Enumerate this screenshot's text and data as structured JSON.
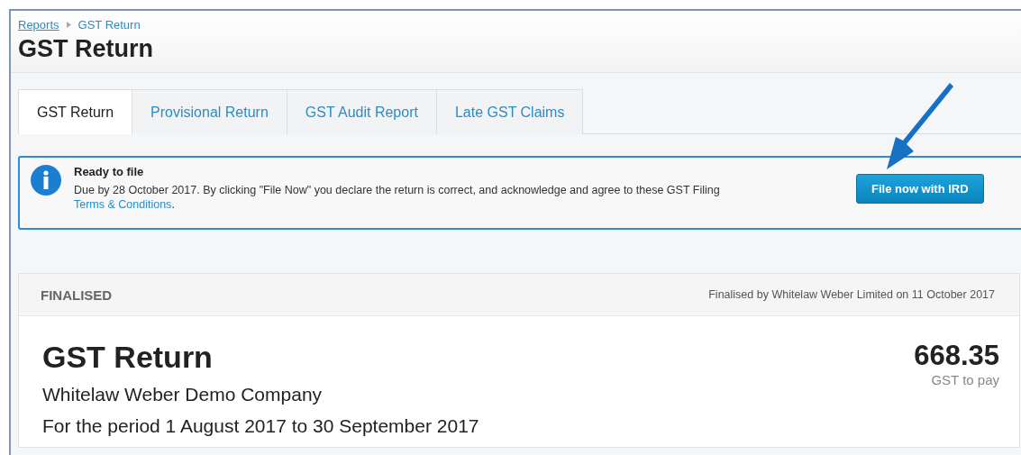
{
  "breadcrumb": {
    "link": "Reports",
    "current": "GST Return"
  },
  "title": "GST Return",
  "tabs": [
    {
      "label": "GST Return",
      "selected": true
    },
    {
      "label": "Provisional Return",
      "selected": false
    },
    {
      "label": "GST Audit Report",
      "selected": false
    },
    {
      "label": "Late GST Claims",
      "selected": false
    }
  ],
  "notice": {
    "heading": "Ready to file",
    "text": "Due by 28 October 2017. By clicking \"File Now\" you declare the return is correct, and acknowledge and agree to these GST Filing ",
    "link": "Terms & Conditions",
    "after_link": ".",
    "button": "File now with IRD"
  },
  "report": {
    "status": "FINALISED",
    "finalised_by": "Finalised by Whitelaw Weber Limited on 11 October 2017",
    "title": "GST Return",
    "company": "Whitelaw Weber Demo Company",
    "period": "For the period 1 August 2017 to 30 September 2017",
    "amount": "668.35",
    "amount_label": "GST to pay"
  }
}
